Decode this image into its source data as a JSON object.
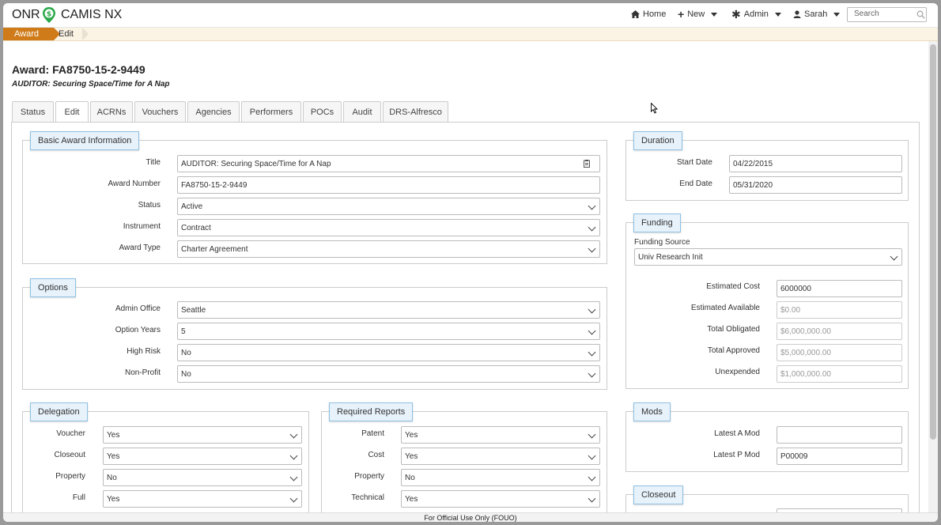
{
  "brand": {
    "left": "ONR",
    "right": "CAMIS NX"
  },
  "nav": {
    "home": "Home",
    "new": "New",
    "admin": "Admin",
    "user": "Sarah",
    "search_placeholder": "Search"
  },
  "breadcrumb": {
    "award": "Award",
    "edit": "Edit"
  },
  "page": {
    "title": "Award: FA8750-15-2-9449",
    "subtitle": "AUDITOR: Securing Space/Time for A Nap"
  },
  "tabs": [
    "Status",
    "Edit",
    "ACRNs",
    "Vouchers",
    "Agencies",
    "Performers",
    "POCs",
    "Audit",
    "DRS-Alfresco"
  ],
  "basic": {
    "legend": "Basic Award Information",
    "title_label": "Title",
    "title_value": "AUDITOR: Securing Space/Time for A Nap",
    "number_label": "Award Number",
    "number_value": "FA8750-15-2-9449",
    "status_label": "Status",
    "status_value": "Active",
    "instrument_label": "Instrument",
    "instrument_value": "Contract",
    "type_label": "Award Type",
    "type_value": "Charter Agreement"
  },
  "options": {
    "legend": "Options",
    "office_label": "Admin Office",
    "office_value": "Seattle",
    "years_label": "Option Years",
    "years_value": "5",
    "risk_label": "High Risk",
    "risk_value": "No",
    "nonprofit_label": "Non-Profit",
    "nonprofit_value": "No"
  },
  "delegation": {
    "legend": "Delegation",
    "voucher_label": "Voucher",
    "voucher_value": "Yes",
    "closeout_label": "Closeout",
    "closeout_value": "Yes",
    "property_label": "Property",
    "property_value": "No",
    "full_label": "Full",
    "full_value": "Yes"
  },
  "reports": {
    "legend": "Required Reports",
    "patent_label": "Patent",
    "patent_value": "Yes",
    "cost_label": "Cost",
    "cost_value": "Yes",
    "property_label": "Property",
    "property_value": "No",
    "technical_label": "Technical",
    "technical_value": "Yes"
  },
  "duration": {
    "legend": "Duration",
    "start_label": "Start Date",
    "start_value": "04/22/2015",
    "end_label": "End Date",
    "end_value": "05/31/2020"
  },
  "funding": {
    "legend": "Funding",
    "source_label": "Funding Source",
    "source_value": "Univ Research Init",
    "est_cost_label": "Estimated Cost",
    "est_cost_value": "6000000",
    "est_avail_label": "Estimated Available",
    "est_avail_value": "$0.00",
    "obligated_label": "Total Obligated",
    "obligated_value": "$6,000,000.00",
    "approved_label": "Total Approved",
    "approved_value": "$5,000,000.00",
    "unexpended_label": "Unexpended",
    "unexpended_value": "$1,000,000.00"
  },
  "mods": {
    "legend": "Mods",
    "a_label": "Latest A Mod",
    "a_value": "",
    "p_label": "Latest P Mod",
    "p_value": "P00009"
  },
  "closeout": {
    "legend": "Closeout"
  },
  "footer": "For Official Use Only (FOUO)",
  "colors": {
    "accent": "#cf7b19",
    "legend_bg": "#e7f2fb",
    "logo": "#2aa84a"
  }
}
